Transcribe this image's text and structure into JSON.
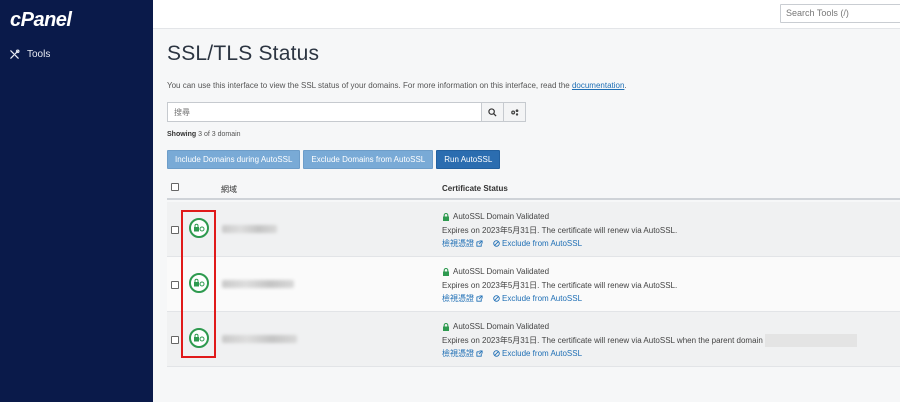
{
  "brand": {
    "logo": "cPanel"
  },
  "sidebar": {
    "items": [
      {
        "label": "Tools",
        "icon": "tools-icon"
      }
    ]
  },
  "topbar": {
    "search_placeholder": "Search Tools (/)"
  },
  "page": {
    "title": "SSL/TLS Status",
    "description": "You can use this interface to view the SSL status of your domains. For more information on this interface, read the ",
    "doc_link": "documentation",
    "desc_end": ".",
    "filter_placeholder": "搜尋",
    "showing_label": "Showing",
    "showing_text": "3 of 3 domain"
  },
  "actions": {
    "include": "Include Domains during AutoSSL",
    "exclude": "Exclude Domains from AutoSSL",
    "run": "Run AutoSSL"
  },
  "table": {
    "col_domain": "網域",
    "col_cert": "Certificate Status",
    "rows": [
      {
        "status": "AutoSSL Domain Validated",
        "expires": "Expires on 2023年5月31日. The certificate will renew via AutoSSL.",
        "view_link": "檢視憑證",
        "exclude_link": "Exclude from AutoSSL"
      },
      {
        "status": "AutoSSL Domain Validated",
        "expires": "Expires on 2023年5月31日. The certificate will renew via AutoSSL.",
        "view_link": "檢視憑證",
        "exclude_link": "Exclude from AutoSSL"
      },
      {
        "status": "AutoSSL Domain Validated",
        "expires": "Expires on 2023年5月31日. The certificate will renew via AutoSSL when the parent domain",
        "view_link": "檢視憑證",
        "exclude_link": "Exclude from AutoSSL"
      }
    ]
  },
  "colors": {
    "sidebar": "#0a1a4a",
    "primary": "#2b6db0",
    "accent_green": "#2e9a4f",
    "highlight": "#e01a1a"
  }
}
